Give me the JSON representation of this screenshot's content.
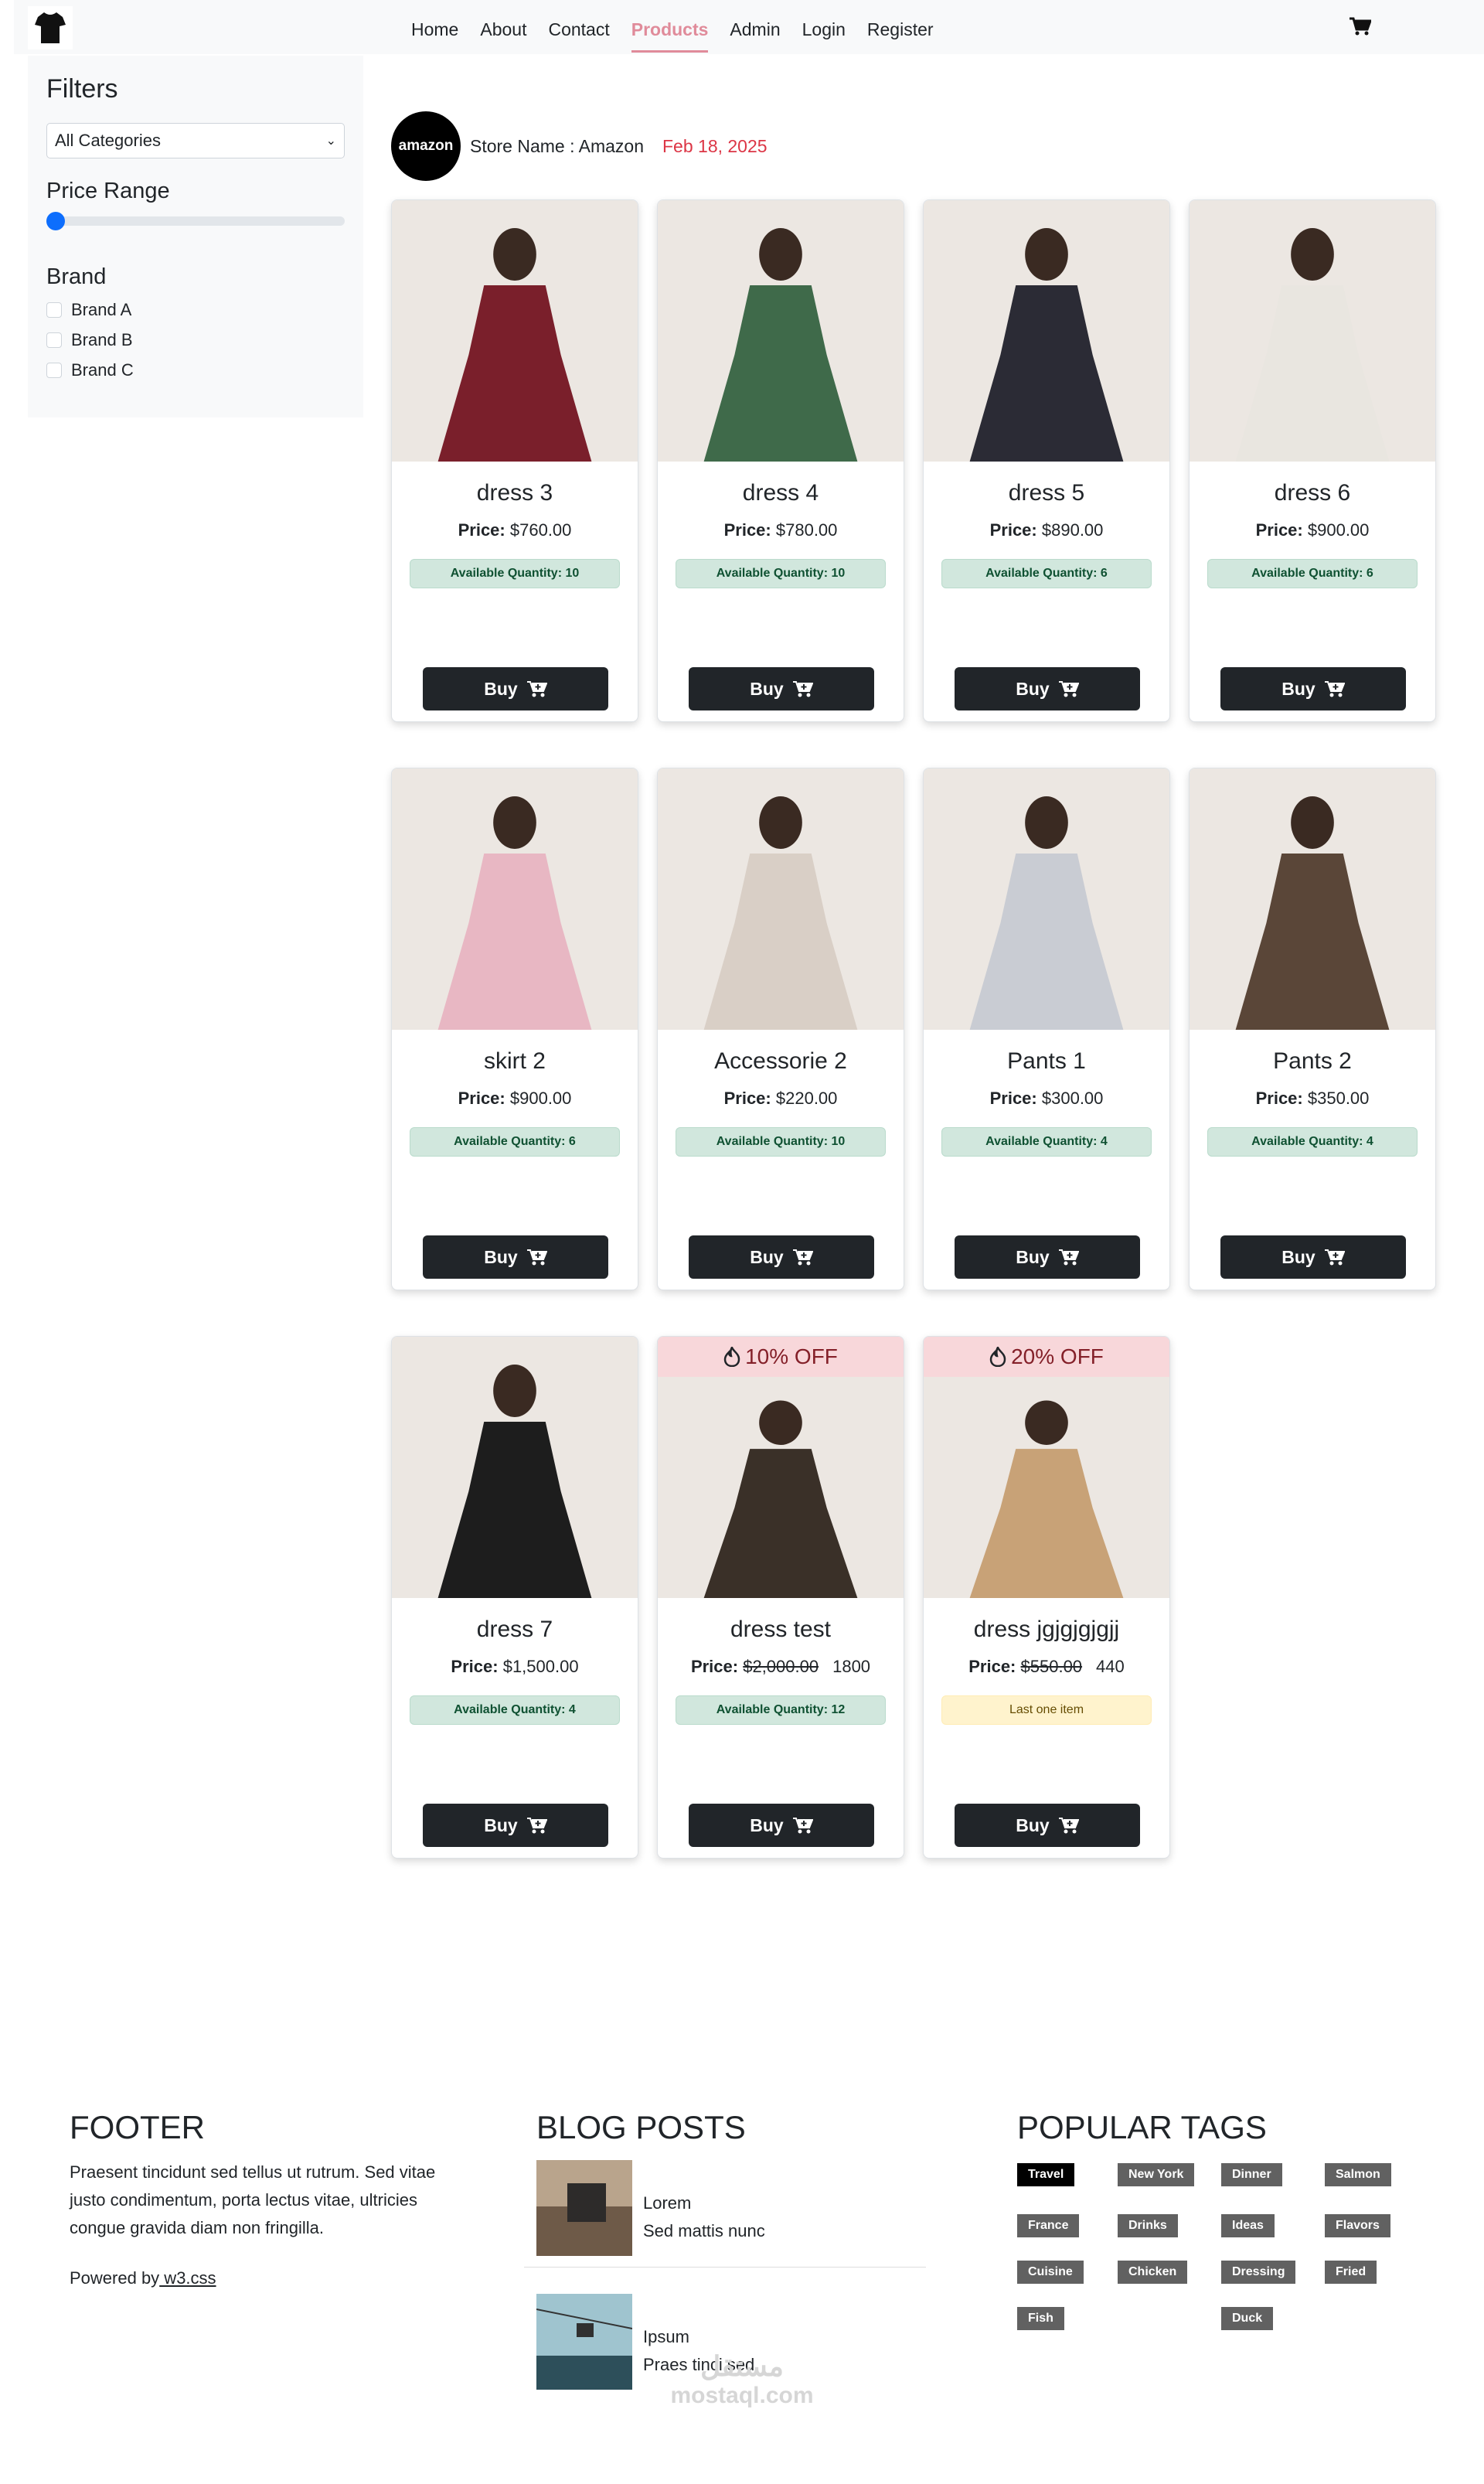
{
  "nav": {
    "items": [
      "Home",
      "About",
      "Contact",
      "Products",
      "Admin",
      "Login",
      "Register"
    ],
    "active": "Products"
  },
  "sidebar": {
    "title": "Filters",
    "category_select": "All Categories",
    "price_label": "Price Range",
    "price_value_fraction": 0,
    "brand_label": "Brand",
    "brands": [
      "Brand A",
      "Brand B",
      "Brand C"
    ]
  },
  "store": {
    "logo_text": "amazon",
    "name": "Store Name : Amazon",
    "date": "Feb 18, 2025"
  },
  "buy_label": "Buy",
  "price_label": "Price:",
  "products": [
    {
      "title": "dress 3",
      "price": "$760.00",
      "qty": "Available Quantity: 10",
      "img": "#7a1f2b"
    },
    {
      "title": "dress 4",
      "price": "$780.00",
      "qty": "Available Quantity: 10",
      "img": "#3f6a4a"
    },
    {
      "title": "dress 5",
      "price": "$890.00",
      "qty": "Available Quantity: 6",
      "img": "#2b2b35"
    },
    {
      "title": "dress 6",
      "price": "$900.00",
      "qty": "Available Quantity: 6",
      "img": "#e9e6e0"
    },
    {
      "title": "skirt 2",
      "price": "$900.00",
      "qty": "Available Quantity: 6",
      "img": "#e8b7c3"
    },
    {
      "title": "Accessorie 2",
      "price": "$220.00",
      "qty": "Available Quantity: 10",
      "img": "#d9cfc6"
    },
    {
      "title": "Pants 1",
      "price": "$300.00",
      "qty": "Available Quantity: 4",
      "img": "#c9ccd3"
    },
    {
      "title": "Pants 2",
      "price": "$350.00",
      "qty": "Available Quantity: 4",
      "img": "#5a4638"
    },
    {
      "title": "dress 7",
      "price": "$1,500.00",
      "qty": "Available Quantity: 4",
      "img": "#1d1d1d"
    },
    {
      "title": "dress test",
      "price": "$2,000.00",
      "new_price": "1800",
      "qty": "Available Quantity: 12",
      "badge": "10% OFF",
      "img": "#3a3028"
    },
    {
      "title": "dress jgjgjgjgjj",
      "price": "$550.00",
      "new_price": "440",
      "qty": "Last one item",
      "badge": "20% OFF",
      "img": "#c8a277"
    }
  ],
  "footer": {
    "title": "FOOTER",
    "text": "Praesent tincidunt sed tellus ut rutrum. Sed vitae justo condimentum, porta lectus vitae, ultricies congue gravida diam non fringilla.",
    "powered_by": "Powered by",
    "powered_link": " w3.css",
    "blog_title": "BLOG POSTS",
    "posts": [
      {
        "title": "Lorem",
        "subtitle": "Sed mattis nunc"
      },
      {
        "title": "Ipsum",
        "subtitle": "Praes tinci sed"
      }
    ],
    "tags_title": "POPULAR TAGS",
    "tags": [
      "Travel",
      "New York",
      "Dinner",
      "Salmon",
      "France",
      "Drinks",
      "Ideas",
      "Flavors",
      "Cuisine",
      "Chicken",
      "Dressing",
      "Fried",
      "Fish",
      "Duck"
    ]
  },
  "watermark": {
    "line1": "مستقل",
    "line2": "mostaql.com"
  }
}
